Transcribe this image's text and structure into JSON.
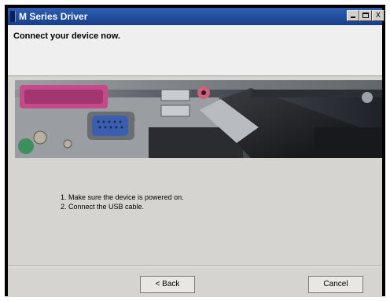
{
  "window": {
    "title": "M Series Driver",
    "controls": {
      "minimize_icon": "minimize-icon",
      "maximize_icon": "maximize-icon",
      "close_label": "X"
    }
  },
  "header": {
    "title": "Connect your device now."
  },
  "banner": {
    "description_icon": "usb-connection-photo"
  },
  "instructions": [
    "1. Make sure the device is powered on.",
    "2. Connect the USB cable."
  ],
  "buttons": {
    "back": "< Back",
    "cancel": "Cancel"
  }
}
